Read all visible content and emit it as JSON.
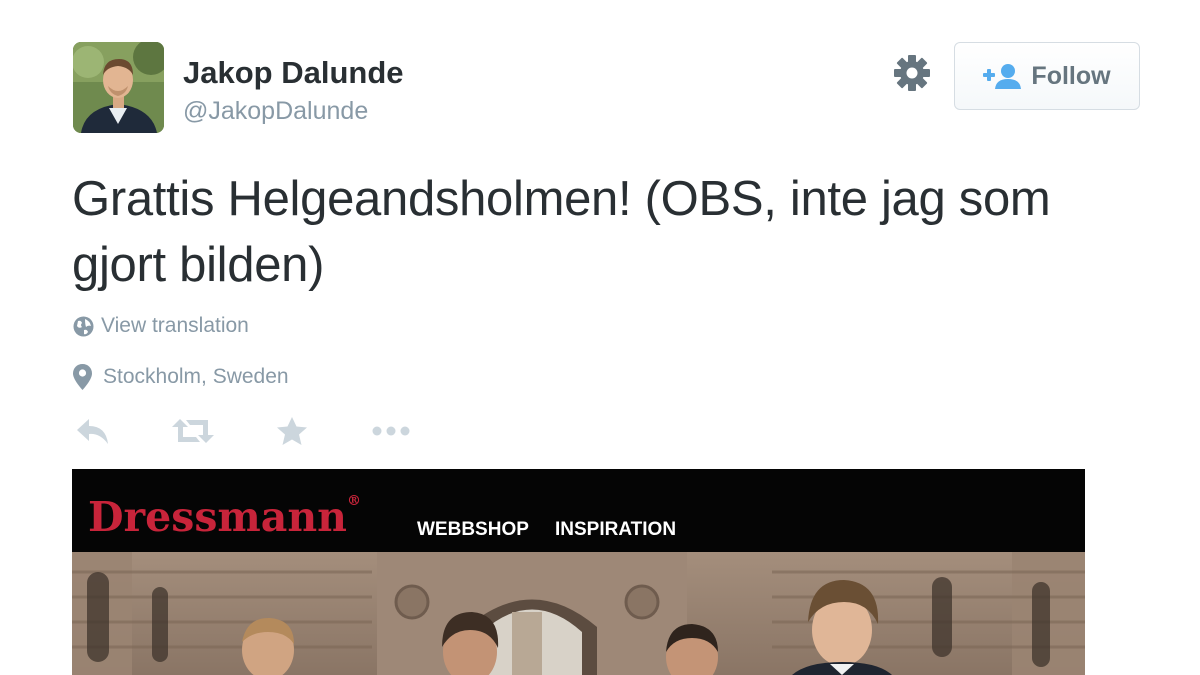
{
  "author": {
    "name": "Jakop Dalunde",
    "handle": "@JakopDalunde"
  },
  "follow_button": {
    "label": "Follow",
    "icon": "add-user-icon"
  },
  "settings": {
    "icon": "gear-icon"
  },
  "tweet": {
    "text": "Grattis Helgeandsholmen! (OBS, inte jag som gjort bilden)",
    "translation_link": "View translation",
    "location": "Stockholm, Sweden"
  },
  "actions": [
    {
      "icon": "reply-icon"
    },
    {
      "icon": "retweet-icon"
    },
    {
      "icon": "favorite-star-icon"
    },
    {
      "icon": "more-icon"
    }
  ],
  "media": {
    "brand": "Dressmann",
    "brand_mark": "®",
    "nav": [
      "WEBBSHOP",
      "INSPIRATION"
    ]
  },
  "colors": {
    "text": "#292f33",
    "muted": "#8899a6",
    "follow_icon": "#55acee",
    "brand_red": "#c8243a"
  }
}
